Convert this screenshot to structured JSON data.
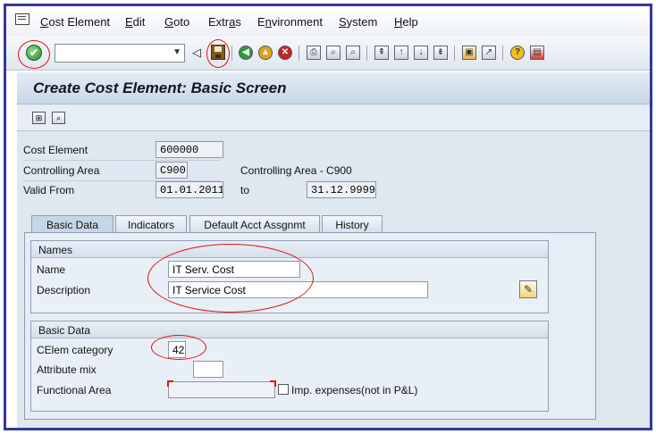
{
  "menu": {
    "items": [
      {
        "pre": "",
        "u": "C",
        "post": "ost Element"
      },
      {
        "pre": "",
        "u": "E",
        "post": "dit"
      },
      {
        "pre": "",
        "u": "G",
        "post": "oto"
      },
      {
        "pre": "Extr",
        "u": "a",
        "post": "s"
      },
      {
        "pre": "E",
        "u": "n",
        "post": "vironment"
      },
      {
        "pre": "",
        "u": "S",
        "post": "ystem"
      },
      {
        "pre": "",
        "u": "H",
        "post": "elp"
      }
    ]
  },
  "toolbar": {
    "command_field_value": "",
    "icons": [
      "enter-icon",
      "back-icon",
      "save-icon",
      "back-green-icon",
      "exit-yellow-icon",
      "cancel-red-icon",
      "print-icon",
      "find-icon",
      "find-next-icon",
      "first-page-icon",
      "previous-page-icon",
      "next-page-icon",
      "last-page-icon",
      "create-session-icon",
      "shortcut-icon",
      "help-icon",
      "customize-layout-icon"
    ]
  },
  "screen": {
    "title": "Create Cost Element: Basic Screen"
  },
  "header": {
    "cost_element_label": "Cost Element",
    "cost_element_value": "600000",
    "controlling_area_label": "Controlling Area",
    "controlling_area_value": "C900",
    "controlling_area_desc": "Controlling Area - C900",
    "valid_from_label": "Valid From",
    "valid_from_value": "01.01.2011",
    "to_label": "to",
    "valid_to_value": "31.12.9999"
  },
  "tabs": [
    {
      "label": "Basic Data",
      "active": true
    },
    {
      "label": "Indicators",
      "active": false
    },
    {
      "label": "Default Acct Assgnmt",
      "active": false
    },
    {
      "label": "History",
      "active": false
    }
  ],
  "names_group": {
    "title": "Names",
    "name_label": "Name",
    "name_value": "IT Serv. Cost",
    "description_label": "Description",
    "description_value": "IT Service Cost"
  },
  "basic_data_group": {
    "title": "Basic Data",
    "celem_category_label": "CElem category",
    "celem_category_value": "42",
    "attribute_mix_label": "Attribute mix",
    "attribute_mix_value": "",
    "functional_area_label": "Functional Area",
    "functional_area_value": "",
    "imp_expenses_label": "Imp. expenses(not in P&L)",
    "imp_expenses_checked": false
  },
  "colors": {
    "frame": "#2f3a9b",
    "highlight_circle": "#dd1111"
  }
}
